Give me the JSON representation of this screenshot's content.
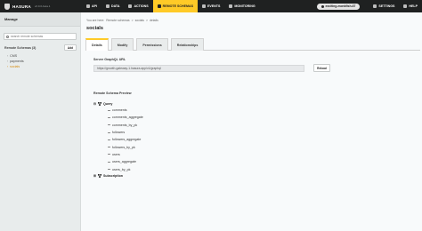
{
  "topnav": {
    "brand": "HASURA",
    "version": "v2.0.0-beta.1",
    "items": [
      {
        "label": "API",
        "icon": "flask-icon"
      },
      {
        "label": "DATA",
        "icon": "database-icon"
      },
      {
        "label": "ACTIONS",
        "icon": "cog-icon"
      },
      {
        "label": "REMOTE SCHEMAS",
        "icon": "plug-icon",
        "active": true
      },
      {
        "label": "EVENTS",
        "icon": "cloud-icon"
      },
      {
        "label": "MONITORING",
        "icon": "monitor-icon"
      }
    ],
    "project": "exciting-monkfish-67",
    "settings": "SETTINGS",
    "help": "HELP",
    "accent": "#ffca27"
  },
  "sidebar": {
    "title": "Manage",
    "search_placeholder": "search remote schemas",
    "schemas_title": "Remote Schemas (3)",
    "add_label": "Add",
    "items": [
      {
        "label": "CMS",
        "active": false
      },
      {
        "label": "payments",
        "active": false
      },
      {
        "label": "socials",
        "active": true
      }
    ]
  },
  "main": {
    "breadcrumb": [
      "You are here:",
      "Remote schemas",
      ">",
      "socials",
      ">",
      "details"
    ],
    "title": "socials",
    "tabs": [
      {
        "label": "Details",
        "active": true
      },
      {
        "label": "Modify",
        "active": false
      },
      {
        "label": "Permissions",
        "active": false
      },
      {
        "label": "Relationships",
        "active": false
      }
    ],
    "server_label": "Server GraphQL URL",
    "server_url": "https://growth-gateway-1.hasura.app/v1/graphql",
    "reload_label": "Reload",
    "preview_label": "Remote Schema Preview",
    "query_label": "Query",
    "query_fields": [
      "comments",
      "comments_aggregate",
      "comments_by_pk",
      "followers",
      "followers_aggregate",
      "followers_by_pk",
      "users",
      "users_aggregate",
      "users_by_pk"
    ],
    "subscription_label": "Subscription"
  }
}
